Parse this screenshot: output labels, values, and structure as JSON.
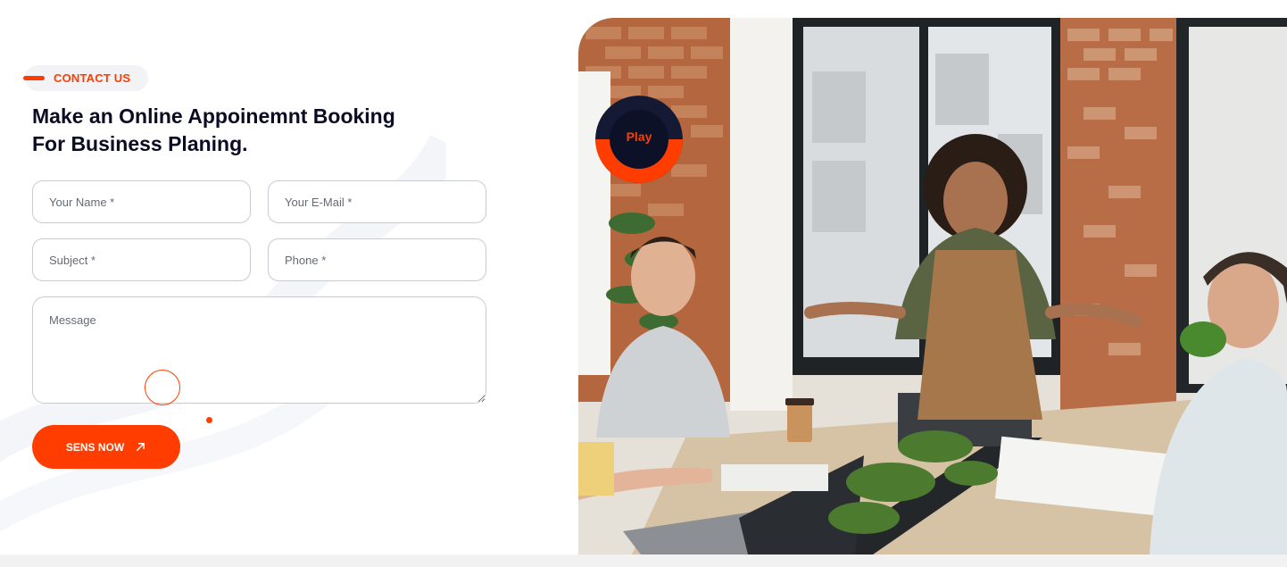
{
  "contact": {
    "tag_label": "CONTACT US",
    "headline_line1": "Make an Online Appoinemnt Booking",
    "headline_line2": "For Business Planing."
  },
  "form": {
    "name_placeholder": "Your Name *",
    "email_placeholder": "Your E-Mail *",
    "subject_placeholder": "Subject *",
    "phone_placeholder": "Phone *",
    "message_placeholder": "Message",
    "submit_label": "SENS NOW"
  },
  "video": {
    "play_label": "Play"
  },
  "colors": {
    "accent": "#ff3d00",
    "heading": "#0b0c24",
    "field_border": "#c9cbd3",
    "play_ring_dark": "#141a33"
  },
  "icons": {
    "submit_icon": "arrow-up-right-icon"
  }
}
